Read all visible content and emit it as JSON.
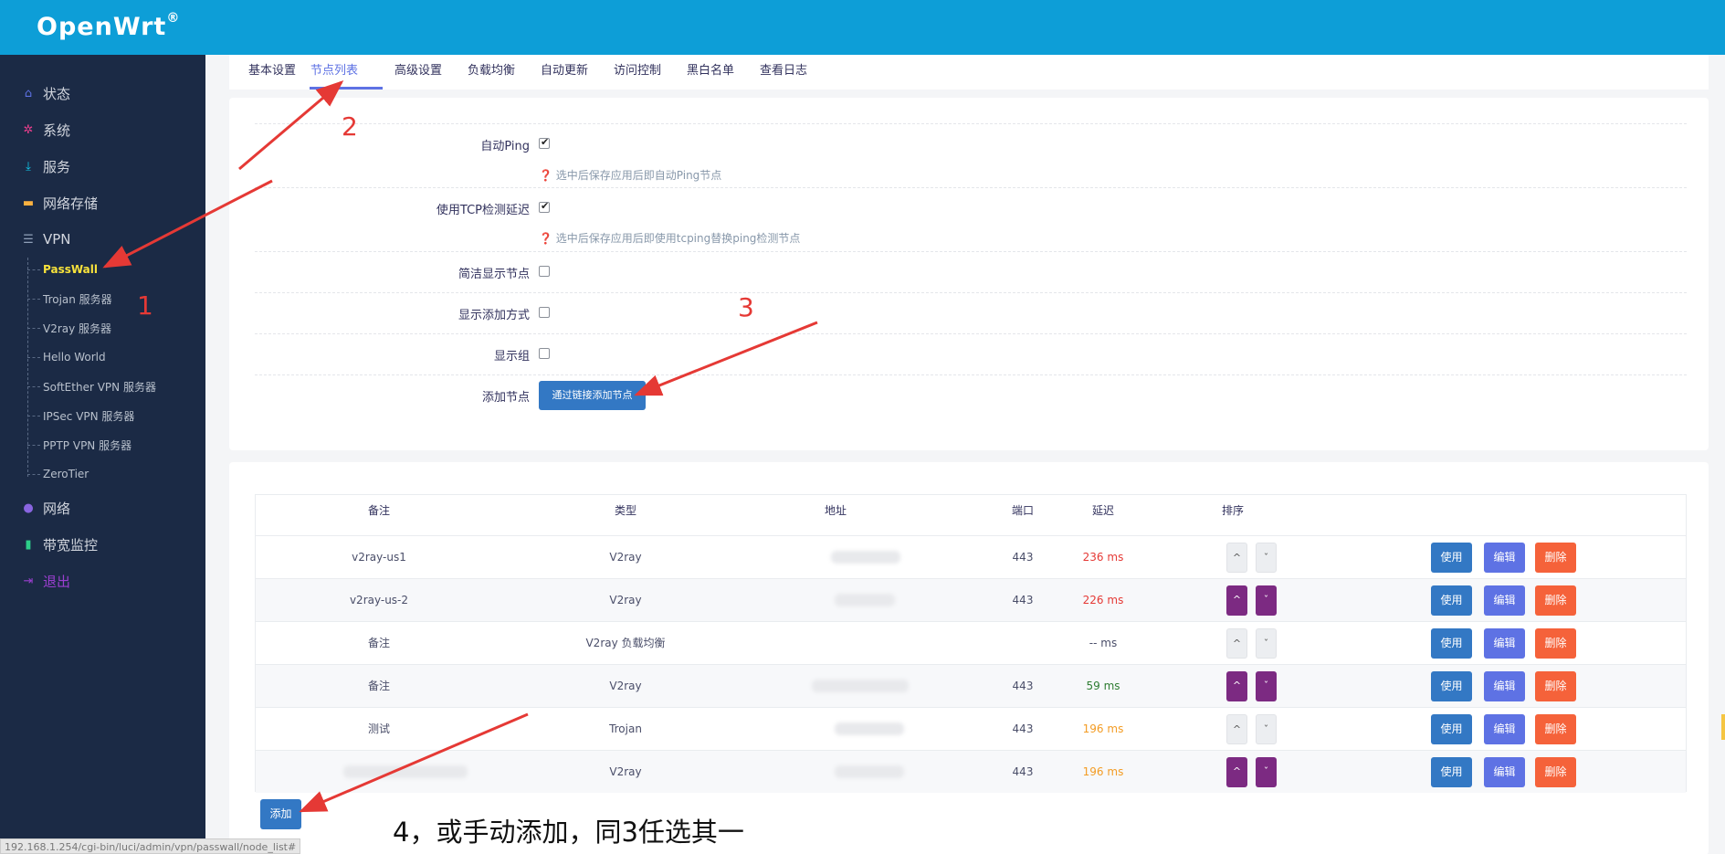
{
  "header": {
    "brand": "OpenWrt",
    "brand_mark": "®"
  },
  "sidebar": {
    "items": [
      {
        "label": "状态",
        "icon": "home-icon"
      },
      {
        "label": "系统",
        "icon": "gear-icon"
      },
      {
        "label": "服务",
        "icon": "download-icon"
      },
      {
        "label": "网络存储",
        "icon": "drive-icon"
      },
      {
        "label": "VPN",
        "icon": "list-icon"
      },
      {
        "label": "网络",
        "icon": "globe-icon"
      },
      {
        "label": "带宽监控",
        "icon": "bar-chart-icon"
      },
      {
        "label": "退出",
        "icon": "logout-icon"
      }
    ],
    "vpn_sub": [
      {
        "label": "PassWall"
      },
      {
        "label": "Trojan 服务器"
      },
      {
        "label": "V2ray 服务器"
      },
      {
        "label": "Hello World"
      },
      {
        "label": "SoftEther VPN 服务器"
      },
      {
        "label": "IPSec VPN 服务器"
      },
      {
        "label": "PPTP VPN 服务器"
      },
      {
        "label": "ZeroTier"
      }
    ]
  },
  "tabs": [
    "基本设置",
    "节点列表",
    "高级设置",
    "负载均衡",
    "自动更新",
    "访问控制",
    "黑白名单",
    "查看日志"
  ],
  "form": {
    "auto_ping_label": "自动Ping",
    "auto_ping_hint": "选中后保存应用后即自动Ping节点",
    "tcp_label": "使用TCP检测延迟",
    "tcp_hint": "选中后保存应用后即使用tcping替换ping检测节点",
    "compact_label": "简洁显示节点",
    "show_add_label": "显示添加方式",
    "show_group_label": "显示组",
    "add_node_label": "添加节点",
    "add_by_link_button": "通过链接添加节点"
  },
  "table": {
    "headers": [
      "备注",
      "类型",
      "地址",
      "端口",
      "延迟",
      "排序"
    ],
    "rows": [
      {
        "remark": "v2ray-us1",
        "type": "V2ray",
        "port": "443",
        "latency": "236 ms",
        "latency_color": "#e53935"
      },
      {
        "remark": "v2ray-us-2",
        "type": "V2ray",
        "port": "443",
        "latency": "226 ms",
        "latency_color": "#e53935"
      },
      {
        "remark": "备注",
        "type": "V2ray 负载均衡",
        "port": "",
        "latency": "-- ms",
        "latency_color": "#4a4e69"
      },
      {
        "remark": "备注",
        "type": "V2ray",
        "port": "443",
        "latency": "59 ms",
        "latency_color": "#2e7d32"
      },
      {
        "remark": "测试",
        "type": "Trojan",
        "port": "443",
        "latency": "196 ms",
        "latency_color": "#f39c24"
      },
      {
        "remark": "",
        "type": "V2ray",
        "port": "443",
        "latency": "196 ms",
        "latency_color": "#f39c24"
      }
    ],
    "use_label": "使用",
    "edit_label": "编辑",
    "delete_label": "删除",
    "up_glyph": "^",
    "down_glyph": "ˇ"
  },
  "add_button": "添加",
  "status_url": "192.168.1.254/cgi-bin/luci/admin/vpn/passwall/node_list#",
  "annotations": {
    "n1": "1",
    "n2": "2",
    "n3": "3",
    "n4": "4，或手动添加，同3任选其一"
  },
  "colors": {
    "header": "#0d9ed7",
    "sidebar": "#1b2a45",
    "accent": "#5e72e4",
    "active_sub": "#f7e23b",
    "arrow": "#e53935"
  }
}
